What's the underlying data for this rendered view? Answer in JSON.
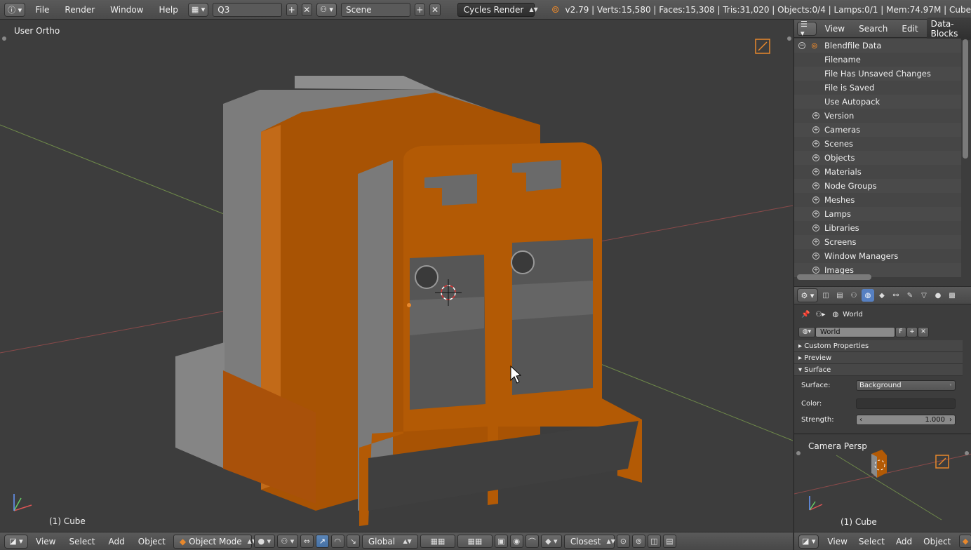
{
  "top_header": {
    "menus": [
      "File",
      "Render",
      "Window",
      "Help"
    ],
    "screen_layout": "Q3",
    "scene": "Scene",
    "render_engine": "Cycles Render",
    "stats": "v2.79 | Verts:15,580 | Faces:15,308 | Tris:31,020 | Objects:0/4 | Lamps:0/1 | Mem:74.97M | Cube"
  },
  "viewport": {
    "view_name": "User Ortho",
    "object_label": "(1) Cube",
    "colors": {
      "orange": "#b35a05",
      "gray": "#7c7c7c",
      "background": "#3d3d3d"
    }
  },
  "bottom_header": {
    "menus": [
      "View",
      "Select",
      "Add",
      "Object"
    ],
    "mode": "Object Mode",
    "orientation": "Global",
    "snap_target": "Closest"
  },
  "outliner": {
    "tabs": [
      "View",
      "Search",
      "Edit"
    ],
    "display_mode": "Data-Blocks",
    "root": "Blendfile Data",
    "leaf_items": [
      "Filename",
      "File Has Unsaved Changes",
      "File is Saved",
      "Use Autopack"
    ],
    "expandable_items": [
      "Version",
      "Cameras",
      "Scenes",
      "Objects",
      "Materials",
      "Node Groups",
      "Meshes",
      "Lamps",
      "Libraries",
      "Screens",
      "Window Managers",
      "Images"
    ]
  },
  "properties": {
    "context_path": "World",
    "world_name": "World",
    "fake_user": "F",
    "panels": {
      "custom_properties": "Custom Properties",
      "preview": "Preview",
      "surface": "Surface"
    },
    "surface_label": "Surface:",
    "surface_value": "Background",
    "color_label": "Color:",
    "strength_label": "Strength:",
    "strength_value": "1.000"
  },
  "camera_view": {
    "view_name": "Camera Persp",
    "object_label": "(1) Cube",
    "menus": [
      "View",
      "Select",
      "Add",
      "Object"
    ]
  }
}
